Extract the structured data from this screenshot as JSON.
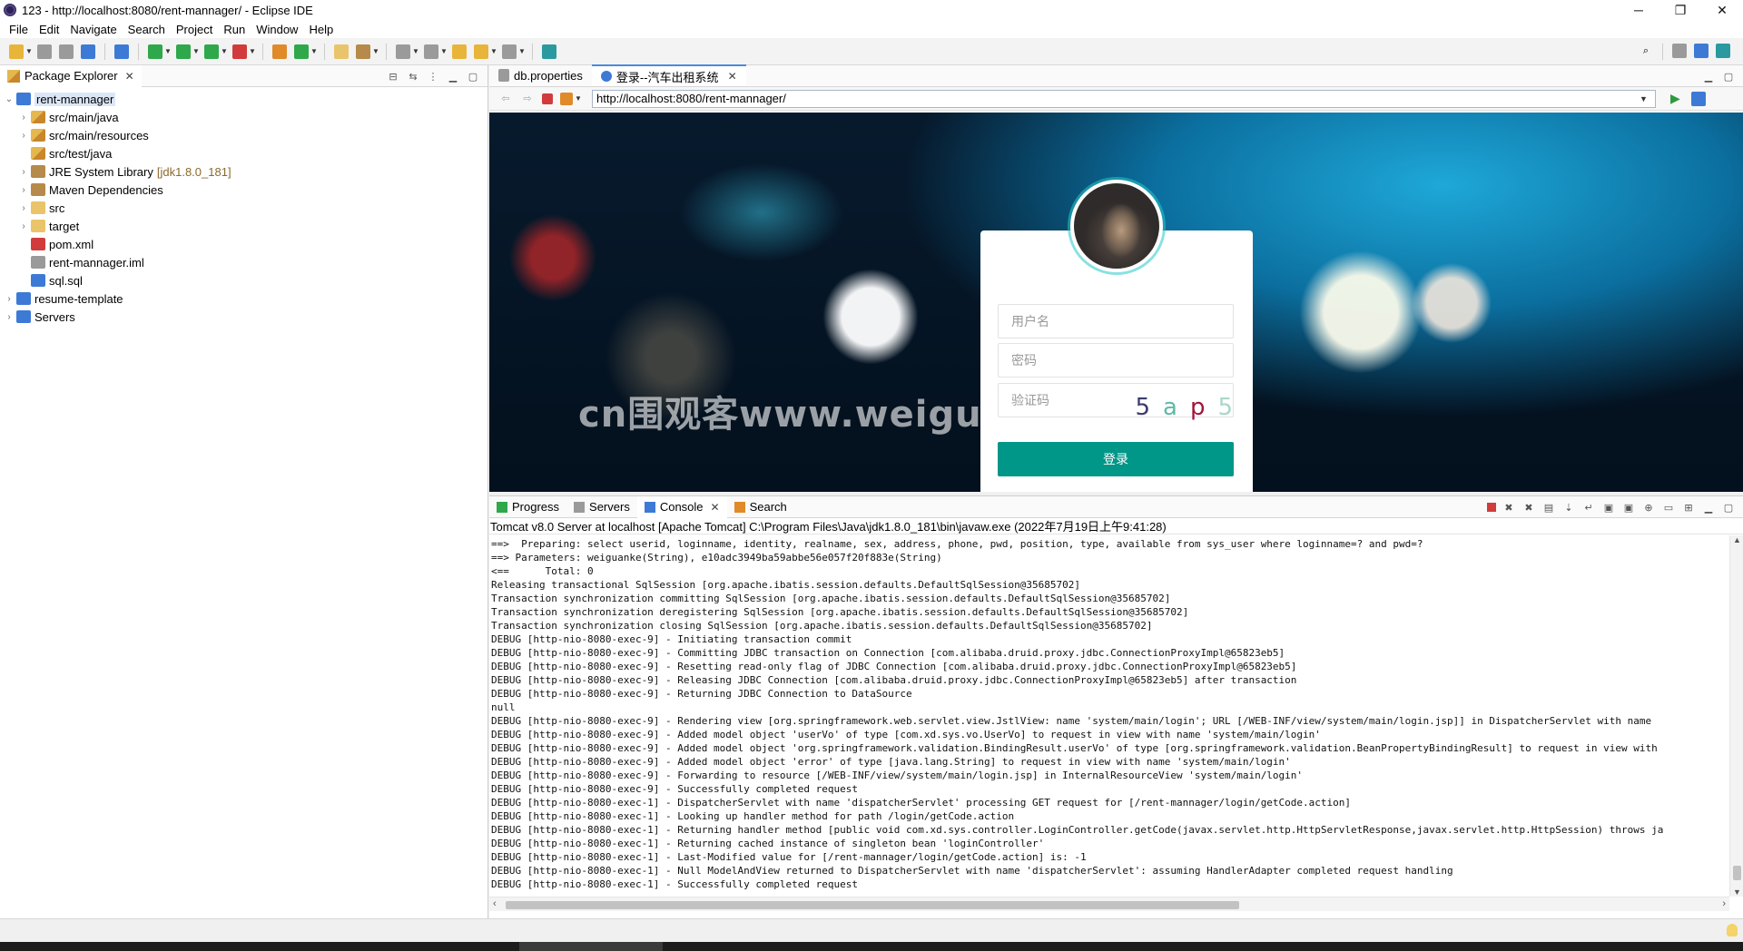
{
  "window": {
    "title": "123 - http://localhost:8080/rent-mannager/ - Eclipse IDE",
    "minimize": "─",
    "restore": "❐",
    "close": "✕"
  },
  "menu": [
    "File",
    "Edit",
    "Navigate",
    "Search",
    "Project",
    "Run",
    "Window",
    "Help"
  ],
  "package_explorer": {
    "tab_label": "Package Explorer",
    "tree": [
      {
        "label": "rent-mannager",
        "decoration": "",
        "expanded": true,
        "level": 0
      },
      {
        "label": "src/main/java",
        "decoration": "",
        "level": 1
      },
      {
        "label": "src/main/resources",
        "decoration": "",
        "level": 1
      },
      {
        "label": "src/test/java",
        "decoration": "",
        "level": 1
      },
      {
        "label": "JRE System Library",
        "decoration": "[jdk1.8.0_181]",
        "level": 1
      },
      {
        "label": "Maven Dependencies",
        "decoration": "",
        "level": 1
      },
      {
        "label": "src",
        "decoration": "",
        "level": 1
      },
      {
        "label": "target",
        "decoration": "",
        "level": 1
      },
      {
        "label": "pom.xml",
        "decoration": "",
        "level": 1
      },
      {
        "label": "rent-mannager.iml",
        "decoration": "",
        "level": 1
      },
      {
        "label": "sql.sql",
        "decoration": "",
        "level": 1
      },
      {
        "label": "resume-template",
        "decoration": "",
        "level": 0
      },
      {
        "label": "Servers",
        "decoration": "",
        "level": 0
      }
    ]
  },
  "editor": {
    "tabs": [
      {
        "label": "db.properties",
        "active": false
      },
      {
        "label": "登录--汽车出租系统",
        "active": true
      }
    ],
    "url": "http://localhost:8080/rent-mannager/"
  },
  "login_page": {
    "username_placeholder": "用户名",
    "password_placeholder": "密码",
    "captcha_placeholder": "验证码",
    "captcha_chars": [
      {
        "ch": "5",
        "color": "#3b3b6e"
      },
      {
        "ch": "a",
        "color": "#5fb8a8"
      },
      {
        "ch": "p",
        "color": "#a0173a"
      },
      {
        "ch": "5",
        "color": "#a8d8c8"
      }
    ],
    "login_button": "登录",
    "watermark": "cn围观客www.weiguanke.cn",
    "accent_color": "#009688"
  },
  "bottom_panel": {
    "tabs": [
      "Progress",
      "Servers",
      "Console",
      "Search"
    ],
    "active_tab": "Console",
    "console_description": "Tomcat v8.0 Server at localhost [Apache Tomcat] C:\\Program Files\\Java\\jdk1.8.0_181\\bin\\javaw.exe  (2022年7月19日上午9:41:28)",
    "log": [
      "==>  Preparing: select userid, loginname, identity, realname, sex, address, phone, pwd, position, type, available from sys_user where loginname=? and pwd=?",
      "==> Parameters: weiguanke(String), e10adc3949ba59abbe56e057f20f883e(String)",
      "<==      Total: 0",
      "Releasing transactional SqlSession [org.apache.ibatis.session.defaults.DefaultSqlSession@35685702]",
      "Transaction synchronization committing SqlSession [org.apache.ibatis.session.defaults.DefaultSqlSession@35685702]",
      "Transaction synchronization deregistering SqlSession [org.apache.ibatis.session.defaults.DefaultSqlSession@35685702]",
      "Transaction synchronization closing SqlSession [org.apache.ibatis.session.defaults.DefaultSqlSession@35685702]",
      "DEBUG [http-nio-8080-exec-9] - Initiating transaction commit",
      "DEBUG [http-nio-8080-exec-9] - Committing JDBC transaction on Connection [com.alibaba.druid.proxy.jdbc.ConnectionProxyImpl@65823eb5]",
      "DEBUG [http-nio-8080-exec-9] - Resetting read-only flag of JDBC Connection [com.alibaba.druid.proxy.jdbc.ConnectionProxyImpl@65823eb5]",
      "DEBUG [http-nio-8080-exec-9] - Releasing JDBC Connection [com.alibaba.druid.proxy.jdbc.ConnectionProxyImpl@65823eb5] after transaction",
      "DEBUG [http-nio-8080-exec-9] - Returning JDBC Connection to DataSource",
      "null",
      "DEBUG [http-nio-8080-exec-9] - Rendering view [org.springframework.web.servlet.view.JstlView: name 'system/main/login'; URL [/WEB-INF/view/system/main/login.jsp]] in DispatcherServlet with name",
      "DEBUG [http-nio-8080-exec-9] - Added model object 'userVo' of type [com.xd.sys.vo.UserVo] to request in view with name 'system/main/login'",
      "DEBUG [http-nio-8080-exec-9] - Added model object 'org.springframework.validation.BindingResult.userVo' of type [org.springframework.validation.BeanPropertyBindingResult] to request in view with",
      "DEBUG [http-nio-8080-exec-9] - Added model object 'error' of type [java.lang.String] to request in view with name 'system/main/login'",
      "DEBUG [http-nio-8080-exec-9] - Forwarding to resource [/WEB-INF/view/system/main/login.jsp] in InternalResourceView 'system/main/login'",
      "DEBUG [http-nio-8080-exec-9] - Successfully completed request",
      "DEBUG [http-nio-8080-exec-1] - DispatcherServlet with name 'dispatcherServlet' processing GET request for [/rent-mannager/login/getCode.action]",
      "DEBUG [http-nio-8080-exec-1] - Looking up handler method for path /login/getCode.action",
      "DEBUG [http-nio-8080-exec-1] - Returning handler method [public void com.xd.sys.controller.LoginController.getCode(javax.servlet.http.HttpServletResponse,javax.servlet.http.HttpSession) throws ja",
      "DEBUG [http-nio-8080-exec-1] - Returning cached instance of singleton bean 'loginController'",
      "DEBUG [http-nio-8080-exec-1] - Last-Modified value for [/rent-mannager/login/getCode.action] is: -1",
      "DEBUG [http-nio-8080-exec-1] - Null ModelAndView returned to DispatcherServlet with name 'dispatcherServlet': assuming HandlerAdapter completed request handling",
      "DEBUG [http-nio-8080-exec-1] - Successfully completed request"
    ]
  }
}
